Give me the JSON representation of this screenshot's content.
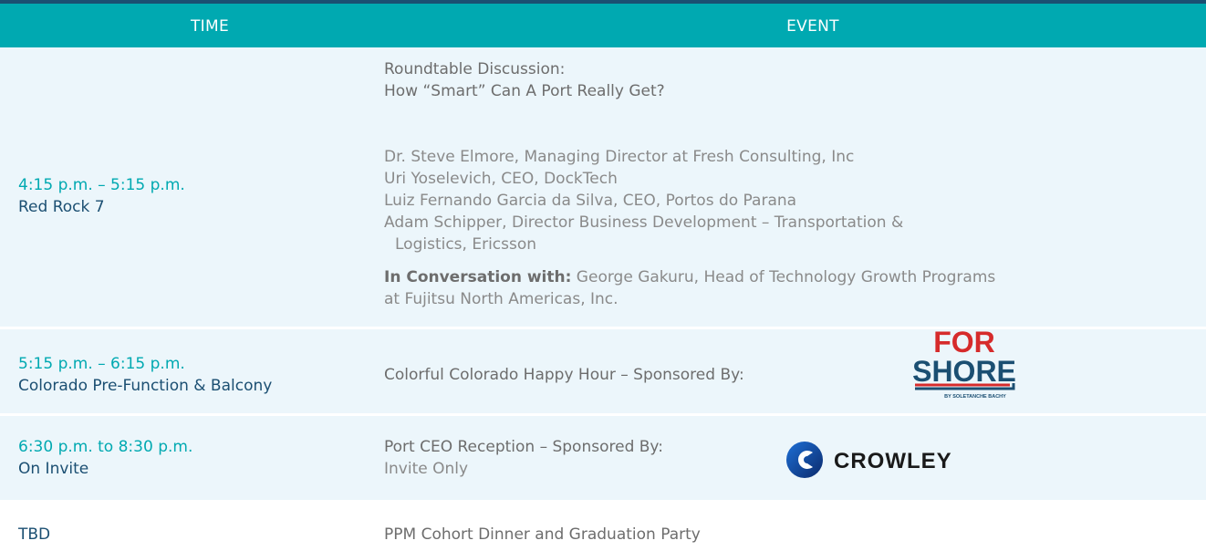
{
  "header": {
    "time_label": "TIME",
    "event_label": "EVENT"
  },
  "rows": [
    {
      "time": "4:15 p.m. – 5:15 p.m.",
      "location": "Red Rock 7",
      "title_line1": "Roundtable Discussion:",
      "title_line2": "How “Smart” Can A Port Really Get?",
      "speakers": [
        "Dr. Steve Elmore, Managing Director at Fresh Consulting, Inc",
        "Uri Yoselevich, CEO, DockTech",
        "Luiz Fernando Garcia da Silva, CEO, Portos do Parana",
        "Adam Schipper, Director Business Development – Transportation &",
        "Logistics, Ericsson"
      ],
      "moderator_label": "In Conversation with:",
      "moderator_text": " George Gakuru, Head of Technology Growth Programs",
      "moderator_text2": "at Fujitsu North Americas, Inc."
    },
    {
      "time": "5:15 p.m. – 6:15 p.m.",
      "location": "Colorado Pre-Function & Balcony",
      "title": "Colorful Colorado Happy Hour – Sponsored By:",
      "sponsor_logo": {
        "line1": "FOR",
        "line2": "SHORE",
        "tagline": "BY SOLETANCHE BACHY"
      }
    },
    {
      "time": "6:30 p.m. to 8:30 p.m.",
      "location": "On Invite",
      "title": "Port CEO Reception – Sponsored By:",
      "subtitle": "Invite Only",
      "sponsor_logo": {
        "name": "CROWLEY"
      }
    },
    {
      "time": "TBD",
      "title": "PPM Cohort Dinner and Graduation Party"
    }
  ],
  "colors": {
    "accent_teal": "#00a9b1",
    "navy": "#1b4f72",
    "row_shade": "#ecf6fb",
    "forshore_red": "#d62b2b"
  }
}
